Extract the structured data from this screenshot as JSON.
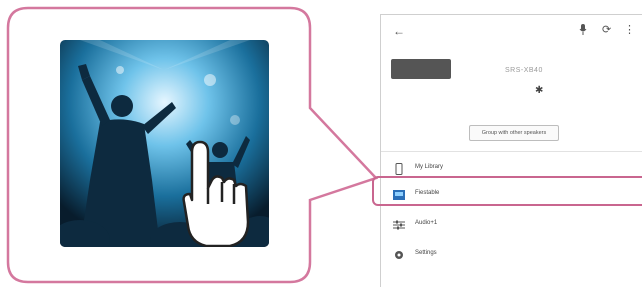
{
  "phone": {
    "back_icon": "←",
    "mic_icon": "🎤",
    "refresh_icon": "⟳",
    "more_icon": "⋮",
    "device_name": "SRS-XB40",
    "bluetooth_icon": "✱",
    "group_button": "Group with other speakers",
    "menu": [
      {
        "label": "My Library",
        "icon": "phone-icon"
      },
      {
        "label": "Fiestable",
        "icon": "fiestable-icon"
      },
      {
        "label": "Audio+1",
        "icon": "equalizer-icon"
      },
      {
        "label": "Settings",
        "icon": "gear-icon"
      }
    ]
  },
  "colors": {
    "callout": "#d4789e",
    "highlight": "#c9668f",
    "concert_light": "#cfe8ff",
    "concert_mid": "#2c95c8",
    "concert_dark": "#0a2438"
  }
}
